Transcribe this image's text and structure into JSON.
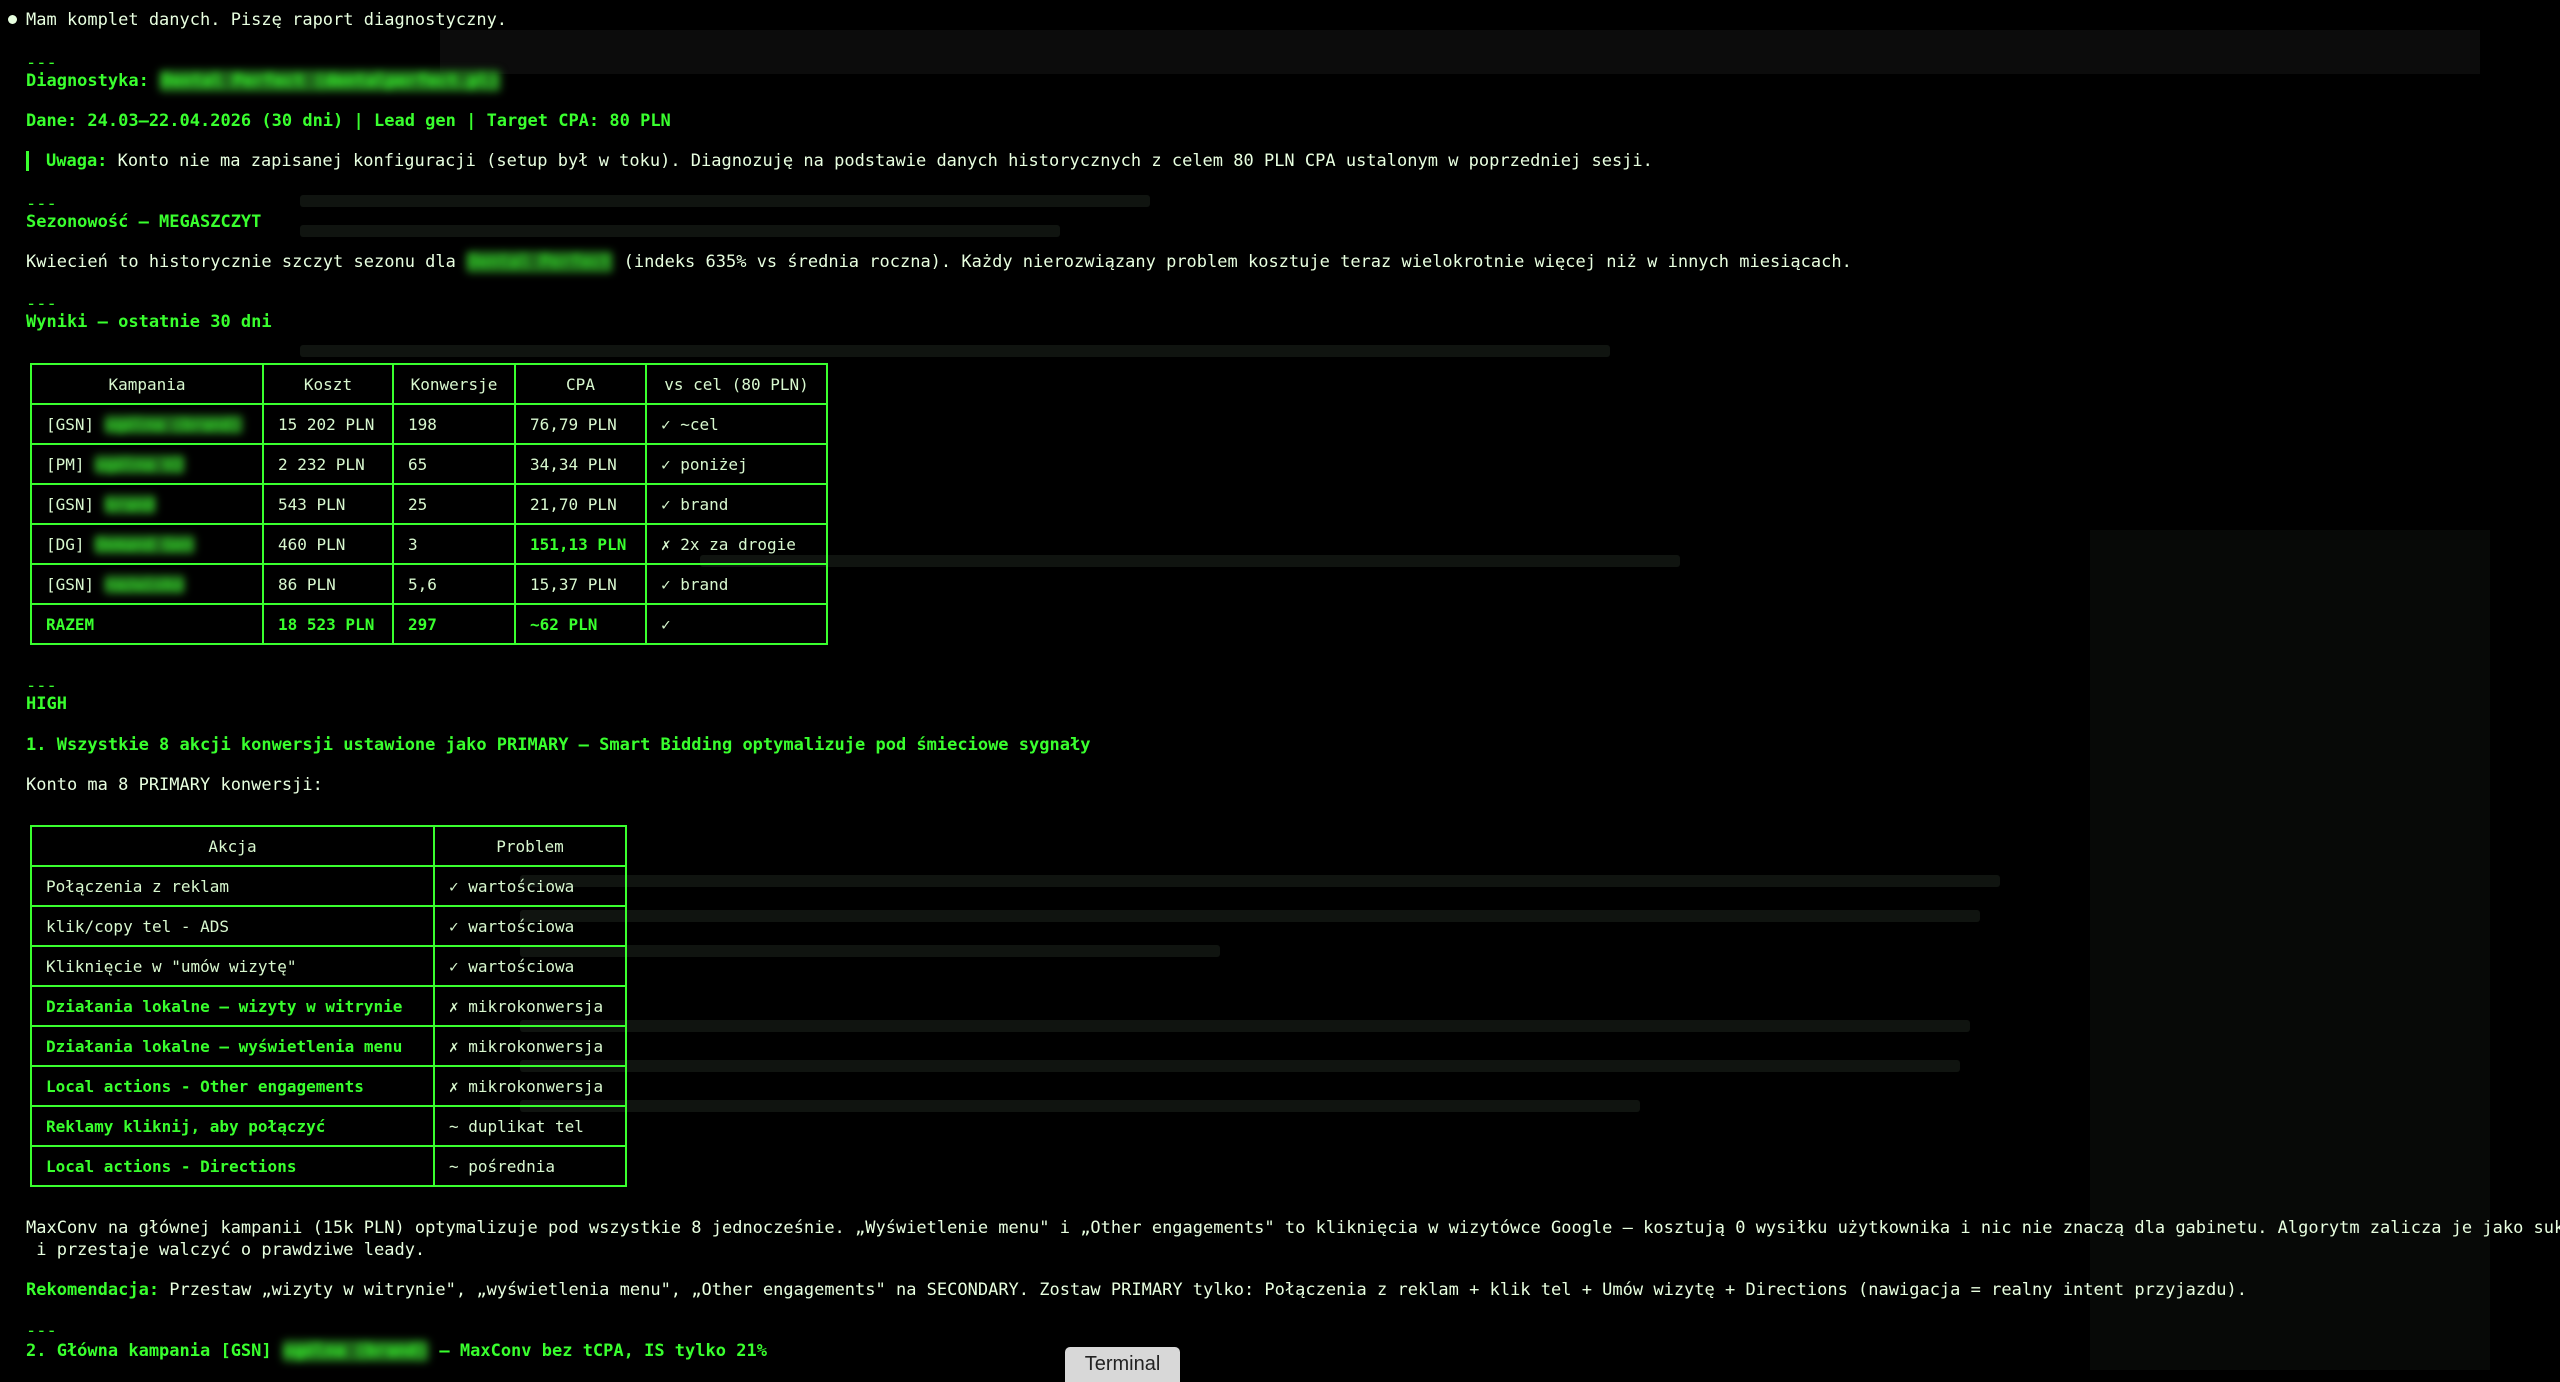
{
  "intro": "Mam komplet danych. Piszę raport diagnostyczny.",
  "separator": "---",
  "diag": {
    "title": "Diagnostyka:",
    "client": "Dental Perfect (dentalperfect.pl)"
  },
  "meta_line": "Dane: 24.03–22.04.2026 (30 dni) | Lead gen | Target CPA: 80 PLN",
  "note": {
    "label": "Uwaga:",
    "text": " Konto nie ma zapisanej konfiguracji (setup był w toku). Diagnozuję na podstawie danych historycznych z celem 80 PLN CPA ustalonym w poprzedniej sesji."
  },
  "season": {
    "heading": "Sezonowość — MEGASZCZYT",
    "text_before": "Kwiecień to historycznie szczyt sezonu dla ",
    "client": "Dental Perfect",
    "text_after": " (indeks 635% vs średnia roczna). Każdy nierozwiązany problem kosztuje teraz wielokrotnie więcej niż w innych miesiącach."
  },
  "results": {
    "heading": "Wyniki — ostatnie 30 dni",
    "headers": [
      "Kampania",
      "Koszt",
      "Konwersje",
      "CPA",
      "vs cel (80 PLN)"
    ],
    "rows": [
      {
        "prefix": "[GSN]",
        "name": "ogólna (brand)",
        "cost": "15 202 PLN",
        "conv": "198",
        "cpa": "76,79 PLN",
        "vs": "✓ ~cel"
      },
      {
        "prefix": "[PM]",
        "name": "ogólna V2",
        "cost": "2 232 PLN",
        "conv": "65",
        "cpa": "34,34 PLN",
        "vs": "✓ poniżej"
      },
      {
        "prefix": "[GSN]",
        "name": "brand",
        "cost": "543 PLN",
        "conv": "25",
        "cpa": "21,70 PLN",
        "vs": "✓ brand"
      },
      {
        "prefix": "[DG]",
        "name": "Demand Gen",
        "cost": "460 PLN",
        "conv": "3",
        "cpa": "151,13 PLN",
        "vs": "✗ 2x za drogie"
      },
      {
        "prefix": "[GSN]",
        "name": "nazwisko",
        "cost": "86 PLN",
        "conv": "5,6",
        "cpa": "15,37 PLN",
        "vs": "✓ brand"
      }
    ],
    "total": {
      "label": "RAZEM",
      "cost": "18 523 PLN",
      "conv": "297",
      "cpa": "~62 PLN",
      "vs": "✓"
    }
  },
  "high": {
    "label": "HIGH",
    "item1": "1. Wszystkie 8 akcji konwersji ustawione jako PRIMARY — Smart Bidding optymalizuje pod śmieciowe sygnały",
    "intro": "Konto ma 8 PRIMARY konwersji:",
    "headers": [
      "Akcja",
      "Problem"
    ],
    "rows": [
      {
        "action": "Połączenia z reklam",
        "problem": "✓ wartościowa",
        "bold": false
      },
      {
        "action": "klik/copy tel - ADS",
        "problem": "✓ wartościowa",
        "bold": false
      },
      {
        "action": "Kliknięcie w \"umów wizytę\"",
        "problem": "✓ wartościowa",
        "bold": false
      },
      {
        "action": "Działania lokalne – wizyty w witrynie",
        "problem": "✗ mikrokonwersja",
        "bold": true
      },
      {
        "action": "Działania lokalne – wyświetlenia menu",
        "problem": "✗ mikrokonwersja",
        "bold": true
      },
      {
        "action": "Local actions - Other engagements",
        "problem": "✗ mikrokonwersja",
        "bold": true
      },
      {
        "action": "Reklamy kliknij, aby połączyć",
        "problem": "~ duplikat tel",
        "bold": true
      },
      {
        "action": "Local actions - Directions",
        "problem": "~ pośrednia",
        "bold": true
      }
    ]
  },
  "maxconv": {
    "line1": "MaxConv na głównej kampanii (15k PLN) optymalizuje pod wszystkie 8 jednocześnie. „Wyświetlenie menu\" i „Other engagements\" to kliknięcia w wizytówce Google — kosztują 0 wysiłku użytkownika i nic nie znaczą dla gabinetu. Algorytm zalicza je jako sukces",
    "line2": " i przestaje walczyć o prawdziwe leady."
  },
  "recommendation": {
    "label": "Rekomendacja:",
    "text": " Przestaw „wizyty w witrynie\", „wyświetlenia menu\", „Other engagements\" na SECONDARY. Zostaw PRIMARY tylko: Połączenia z reklam + klik tel + Umów wizytę + Directions (nawigacja = realny intent przyjazdu)."
  },
  "item2": {
    "before": "2. Główna kampania [GSN] ",
    "name": "ogólna (brand)",
    "after": " — MaxConv bez tCPA, IS tylko 21%"
  },
  "tab_label": "Terminal",
  "colors": {
    "text": "#39ff2e",
    "background": "#000000",
    "white_text": "#e8ffe0"
  }
}
